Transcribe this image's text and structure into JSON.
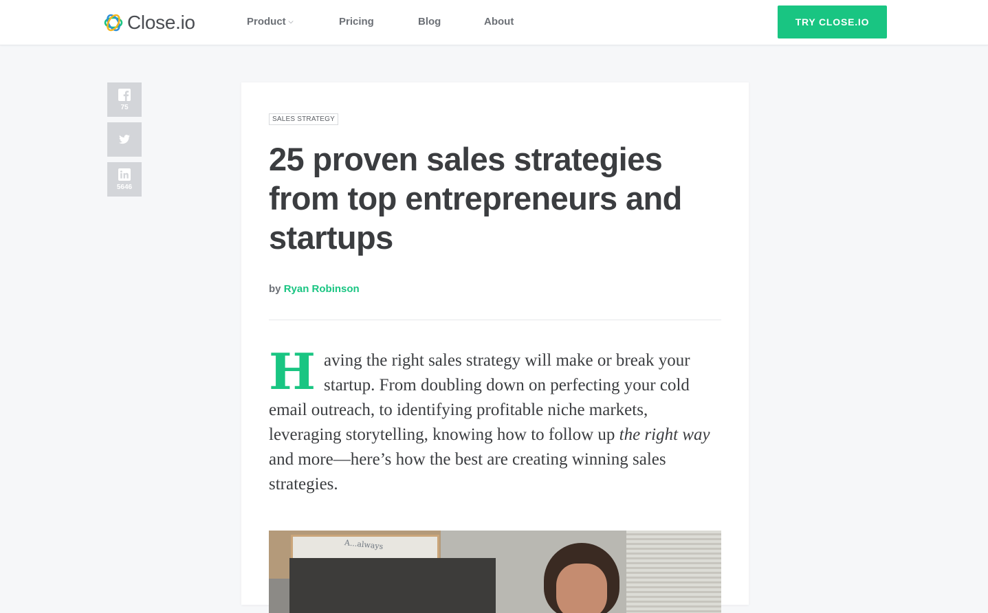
{
  "brand": {
    "name": "Close.io",
    "accent": "#19c582"
  },
  "nav": {
    "items": [
      {
        "label": "Product",
        "has_dropdown": true
      },
      {
        "label": "Pricing"
      },
      {
        "label": "Blog"
      },
      {
        "label": "About"
      }
    ],
    "cta_label": "TRY CLOSE.IO"
  },
  "share": {
    "facebook": {
      "icon": "facebook-icon",
      "count": "75"
    },
    "twitter": {
      "icon": "twitter-icon"
    },
    "linkedin": {
      "icon": "linkedin-icon",
      "count": "5646"
    }
  },
  "article": {
    "category": "SALES STRATEGY",
    "title": "25 proven sales strategies from top entrepreneurs and startups",
    "byline_prefix": "by",
    "author": "Ryan Robinson",
    "intro": {
      "dropcap": "H",
      "lead": "aving the right sales strategy will make or break your startup. From doubling down on perfecting your cold email outreach, to identifying profitable niche markets, leveraging storytelling, knowing how to follow up ",
      "emphasis": "the right way",
      "tail": " and more—here’s how the best are creating winning sales strategies."
    },
    "hero_image_text": "A...always"
  }
}
